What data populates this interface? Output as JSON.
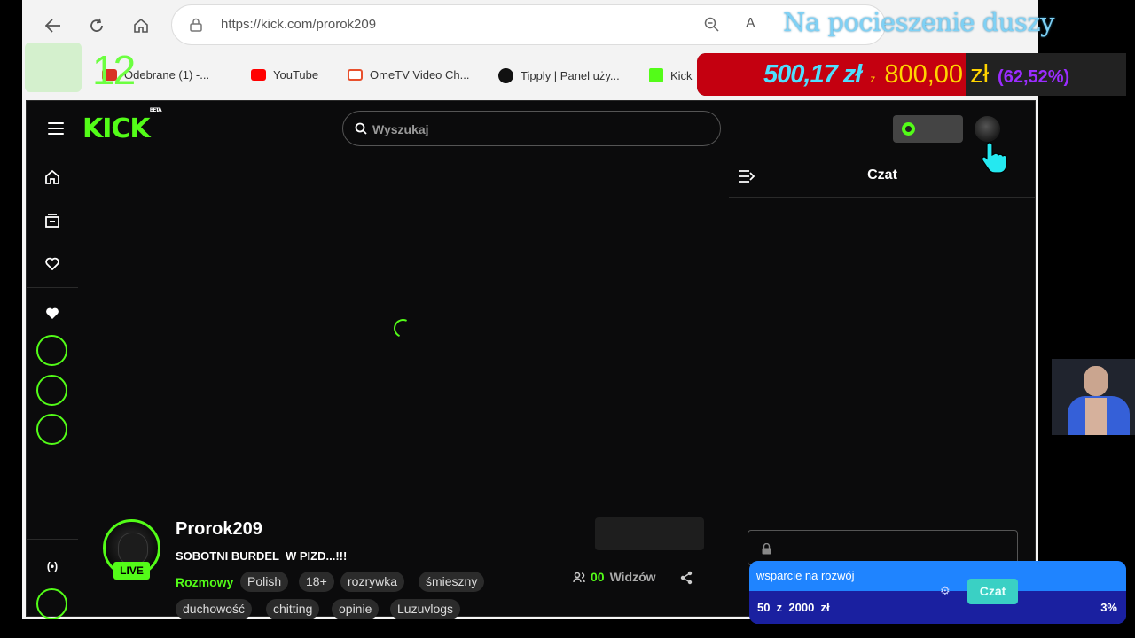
{
  "browser": {
    "url": "https://kick.com/prorok209",
    "reader_label": "A",
    "nav": [
      "back-icon",
      "refresh-icon",
      "home-icon"
    ]
  },
  "overlay": {
    "title": "Na pocieszenie duszy",
    "counter": "12"
  },
  "bookmarks": [
    {
      "label": "Odebrane (1) -...",
      "icon": "mail-icon",
      "color": "#d93025"
    },
    {
      "label": "YouTube",
      "icon": "youtube-icon",
      "color": "#ff0000"
    },
    {
      "label": "OmeTV Video Ch...",
      "icon": "ometv-icon",
      "color": "#e8502d"
    },
    {
      "label": "Tipply | Panel uży...",
      "icon": "tipply-icon",
      "color": "#111111"
    },
    {
      "label": "Kick",
      "icon": "kick-icon",
      "color": "#53fc18"
    }
  ],
  "goal": {
    "current": "500,17 zł",
    "separator": "z",
    "target": "800,00 zł",
    "percent": "(62,52%)",
    "progress": 0.6252
  },
  "kick": {
    "logo": "KICK",
    "logo_badge": "BETA",
    "search_placeholder": "Wyszukaj",
    "chat_title": "Czat",
    "accent": "#53fc18"
  },
  "streamer": {
    "name": "Prorok209",
    "title": "SOBOTNI BURDEL  W PIZD...!!!",
    "live": "LIVE",
    "category": "Rozmowy",
    "tags": [
      "Polish",
      "18+",
      "rozrywka",
      "śmieszny",
      "duchowość",
      "chitting",
      "opinie",
      "Luzuvlogs"
    ],
    "viewers_count": "00",
    "viewers_label": "Widzów"
  },
  "donation": {
    "title": "wsparcie na rozwój",
    "amount": "50  z  2000  zł",
    "percent": "3%",
    "chat_button": "Czat"
  }
}
